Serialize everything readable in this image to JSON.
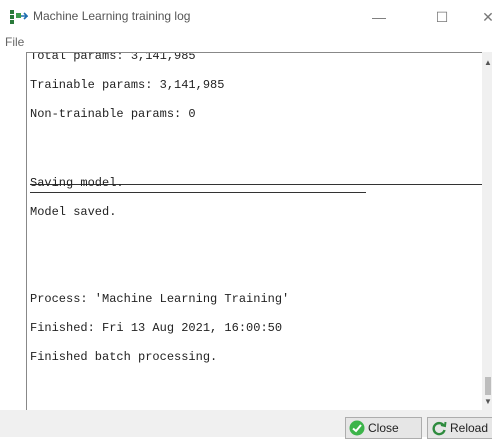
{
  "window": {
    "title": "Machine Learning training log",
    "minimize_glyph": "—",
    "maximize_glyph": "☐",
    "close_glyph": "✕"
  },
  "menu": {
    "file_label": "File"
  },
  "log": {
    "lines": [
      "Total params: 3,141,985",
      "Trainable params: 3,141,985",
      "Non-trainable params: 0",
      "",
      "",
      "Saving model.",
      "Model saved.",
      "",
      "",
      "Process: 'Machine Learning Training'",
      "Finished: Fri 13 Aug 2021, 16:00:50",
      "Finished batch processing."
    ]
  },
  "buttons": {
    "close_label": "Close",
    "reload_label": "Reload"
  },
  "colors": {
    "close_icon": "#3cb44a",
    "reload_icon": "#2e8b3e"
  },
  "icons": {
    "app": "training-app-icon",
    "close": "check-circle-icon",
    "reload": "refresh-icon"
  }
}
